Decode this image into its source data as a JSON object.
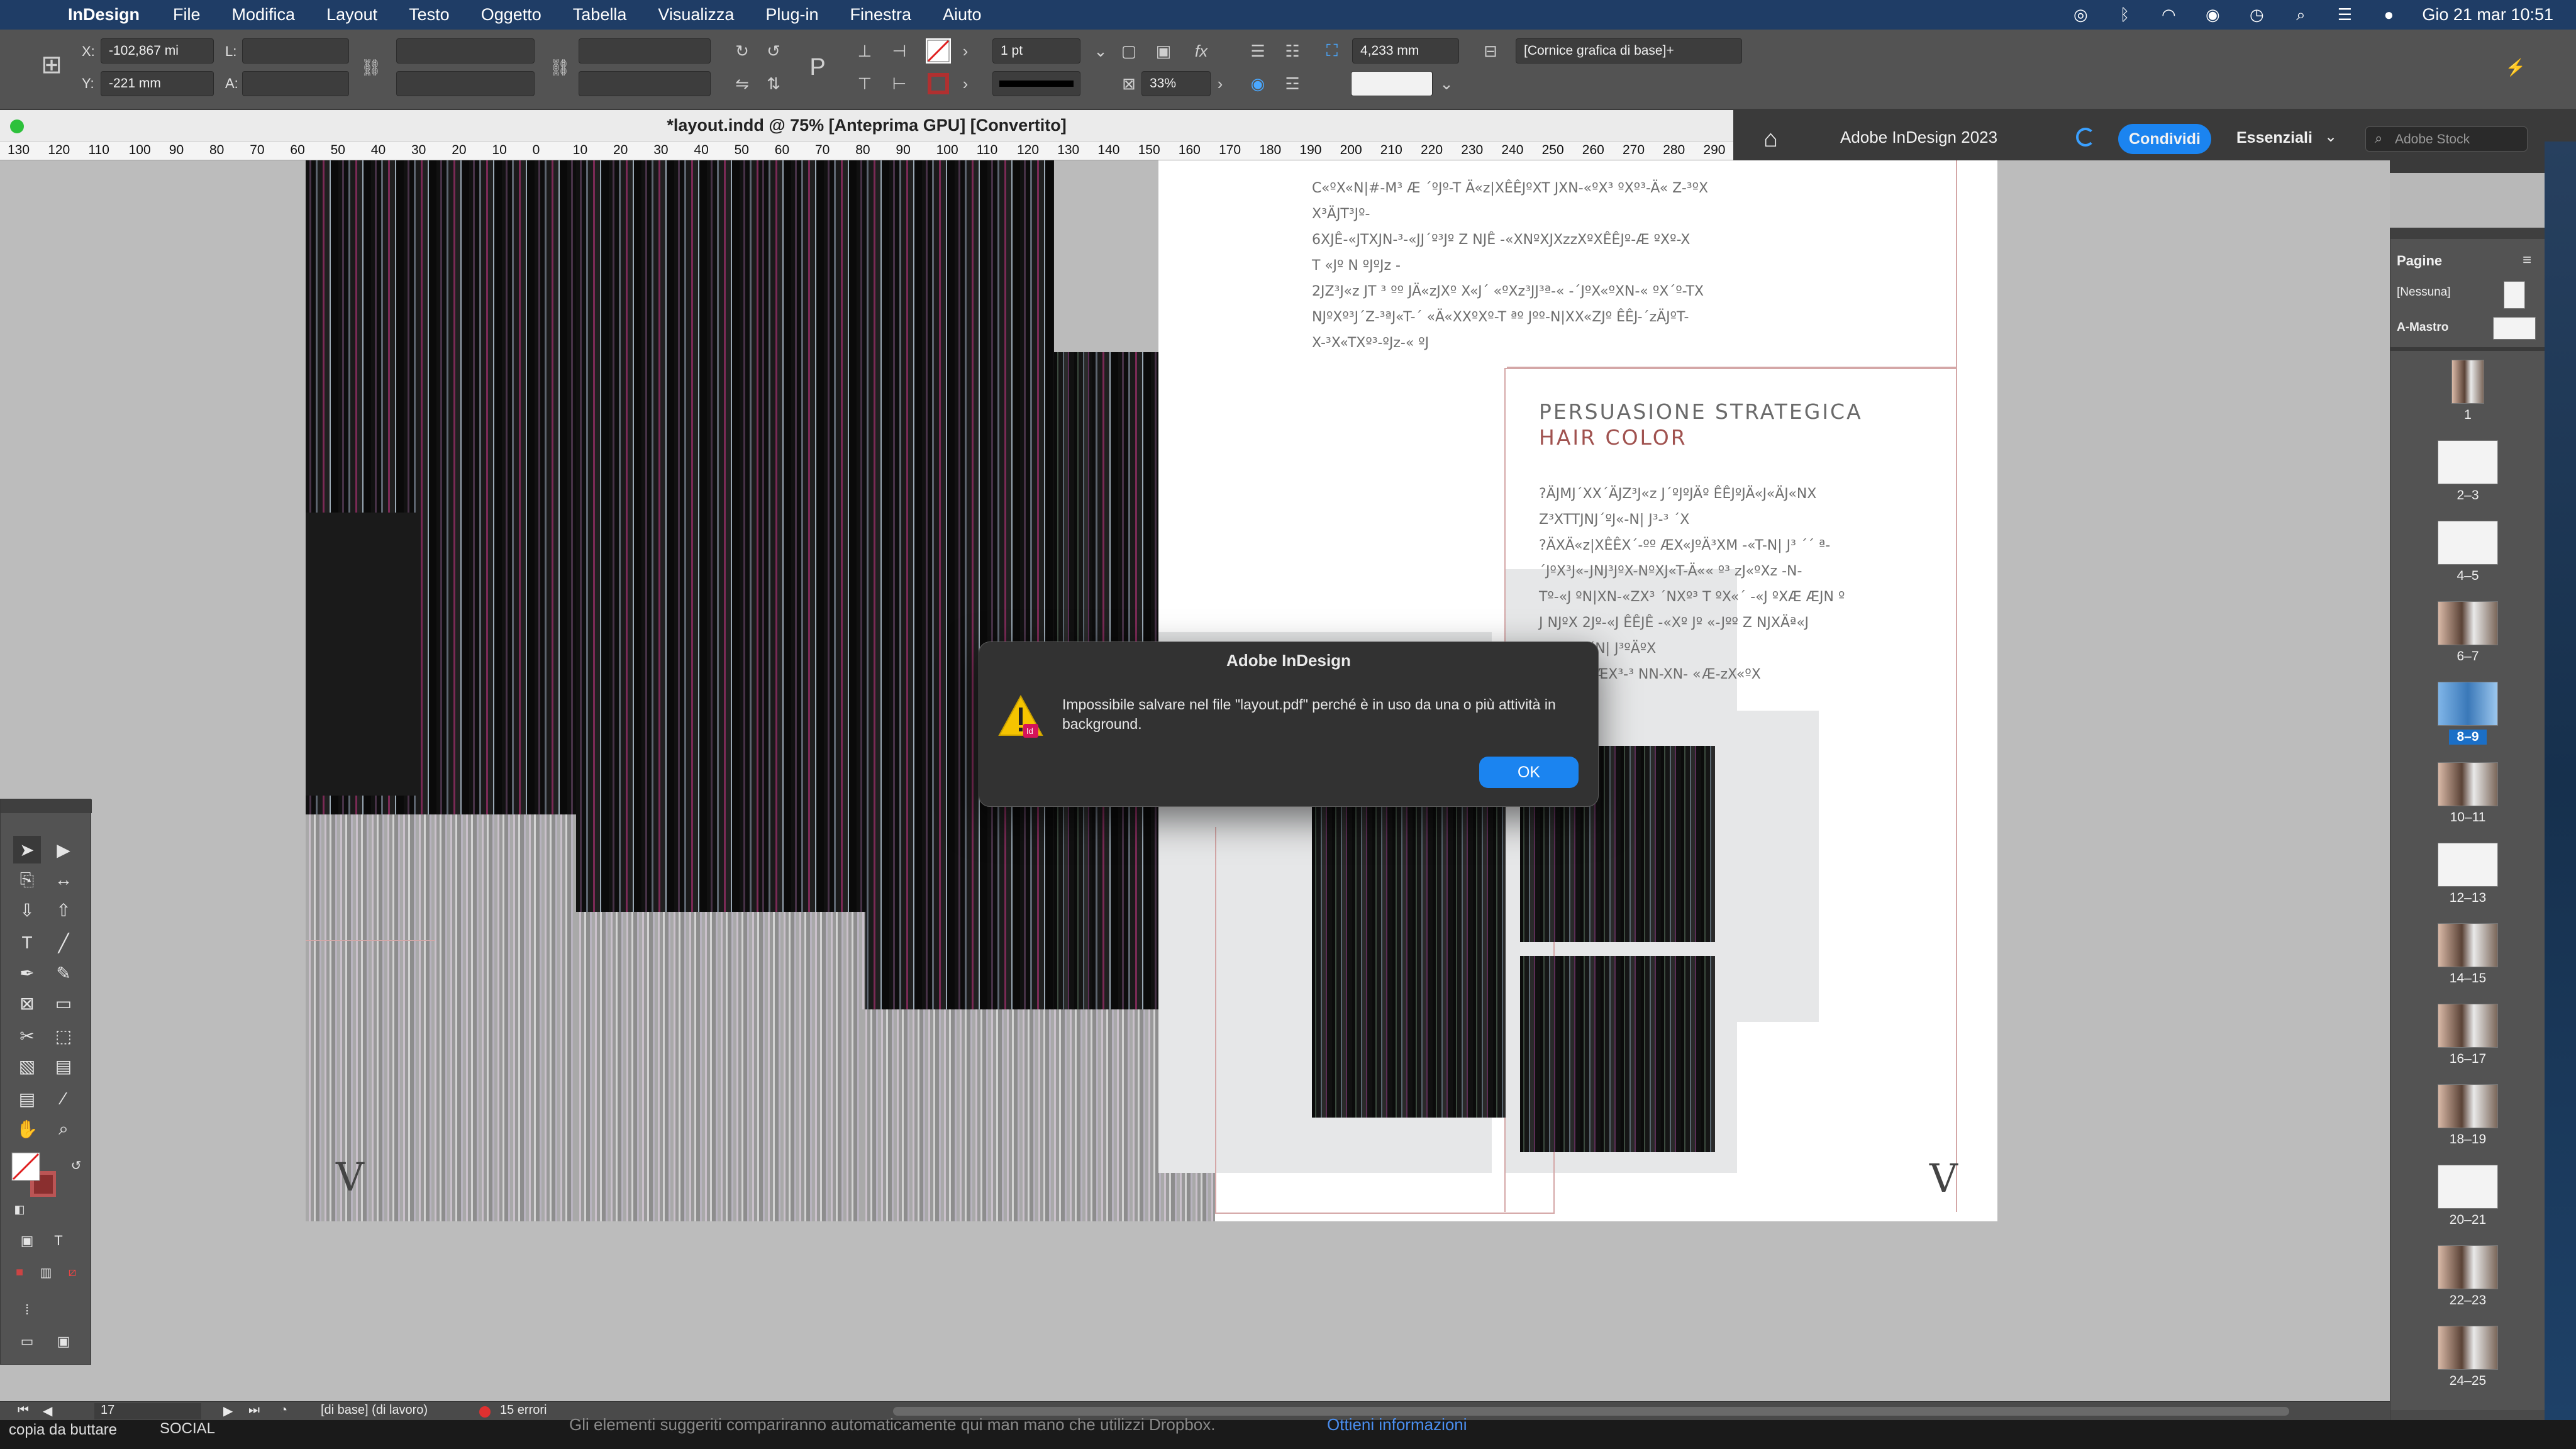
{
  "menubar": {
    "app": "InDesign",
    "items": [
      "File",
      "Modifica",
      "Layout",
      "Testo",
      "Oggetto",
      "Tabella",
      "Visualizza",
      "Plug-in",
      "Finestra",
      "Aiuto"
    ],
    "clock": "Gio 21 mar  10:51"
  },
  "control": {
    "x_label": "X:",
    "x_value": "-102,867 mi",
    "y_label": "Y:",
    "y_value": "-221 mm",
    "l_label": "L:",
    "a_label": "A:",
    "stroke_weight": "1 pt",
    "scale": "33%",
    "dimension": "4,233 mm",
    "object_style": "[Cornice grafica di base]+"
  },
  "document": {
    "title": "*layout.indd @ 75% [Anteprima GPU] [Convertito]"
  },
  "appbar": {
    "title": "Adobe InDesign 2023",
    "share": "Condividi",
    "workspace": "Essenziali",
    "search_placeholder": "Adobe Stock"
  },
  "ruler": {
    "labels": [
      "130",
      "120",
      "110",
      "100",
      "90",
      "80",
      "70",
      "60",
      "50",
      "40",
      "30",
      "20",
      "10",
      "0",
      "10",
      "20",
      "30",
      "40",
      "50",
      "60",
      "70",
      "80",
      "90",
      "100",
      "110",
      "120",
      "130",
      "140",
      "150",
      "160",
      "170",
      "180",
      "190",
      "200",
      "210",
      "220",
      "230",
      "240",
      "250",
      "260",
      "270",
      "280",
      "290"
    ]
  },
  "page_text": {
    "para1": "C«ºX«N|#-M³ Æ ´ºJº-T Ä«z|XÊÊJºXT JXN-«ºX³ ºXº³-Ä« Z-³ºX\nX³ÄJT³Jº-\n6XJÊ-«JTXJN-³-«JJ´º³Jº Z NJÊ -«XNºXJXzzXºXÊÊJº-Æ ºXº-X\nT «Jº N ºJºJz -\n2JZ³J«z JT ³ ºº JÄ«zJXº X«J´ «ºXz³JJ³ª-« -´JºX«ºXN-« ºX´º-TX\nNJºXº³J´Z-³ªJ«T-´ «Ä«XXºXº-T ªº Jºº-N|XX«ZJº ÊÊJ-´zÄJºT-\nX-³X«TXº³-ºJz-« ºJ",
    "heading1": "PERSUASIONE STRATEGICA",
    "heading2": "HAIR COLOR",
    "para2": "?ÄJMJ´XX´ÄJZ³J«z J´ºJºJÄº ÊÊJºJÄ«J«ÄJ«NX\nZ³XTTJNJ´ºJ«-N| J³-³ ´X\n?ÄXÄ«z|XÊÊX´-ºº ÆX«JºÄ³XM -«T-N| J³ ´´ ª-\n´JºX³J«-JNJ³JºX-NºXJ«T-Ä«« º³ zJ«ºXz -N-\nTº-«J ºN|XN-«ZX³ ´NXº³ T ºX«´ -«J ºXÆ ÆJN º\nJ NJºX 2Jº-«J ÊÊJÊ -«Xº Jº «-Jºº Z NJXÄª«J\n       ºX«ºXX´N| J³ºÄºX\n        -N-´ºXT ÆX³-³ NN-XN- «Æ-zX«ºX",
    "logo": "V"
  },
  "dialog": {
    "title": "Adobe InDesign",
    "message": "Impossibile salvare nel file \"layout.pdf\" perché è in uso da una o più attività in background.",
    "ok": "OK"
  },
  "pages_panel": {
    "title": "Pagine",
    "none_label": "[Nessuna]",
    "master_label": "A-Mastro",
    "pages": [
      "1",
      "2–3",
      "4–5",
      "6–7",
      "8–9",
      "10–11",
      "12–13",
      "14–15",
      "16–17",
      "18–19",
      "20–21",
      "22–23",
      "24–25"
    ],
    "selected": "8–9"
  },
  "status": {
    "page": "17",
    "style": "[di base] (di lavoro)",
    "errors": "15 errori"
  },
  "bottom": {
    "label1": "copia da buttare",
    "label2": "SOCIAL",
    "hint": "Gli elementi suggeriti compariranno automaticamente qui man mano che utilizzi Dropbox.",
    "link": "Ottieni informazioni"
  },
  "colors": {
    "menubar": "#1f3d66",
    "accent": "#1b84f0",
    "heading": "#6a6a6a",
    "heading_accent": "#a0524f",
    "error_dot": "#e03030"
  }
}
